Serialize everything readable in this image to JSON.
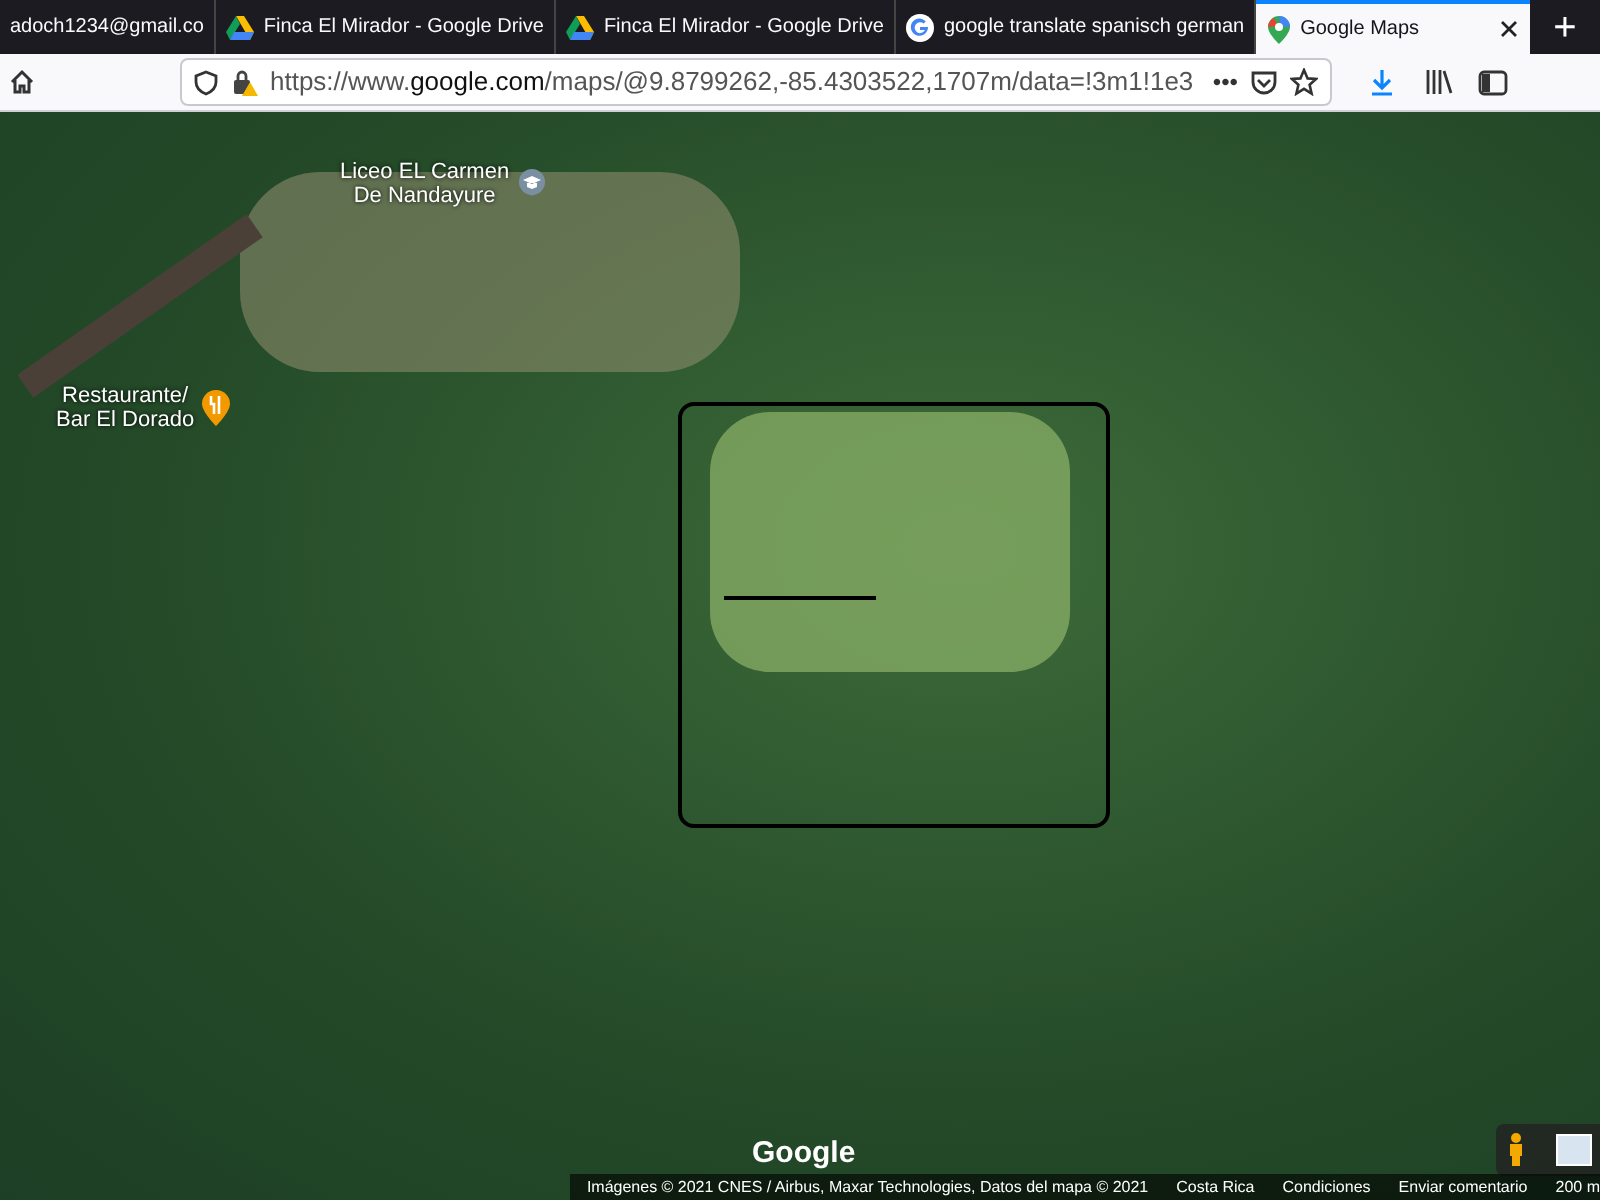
{
  "tabs": [
    {
      "label": "adoch1234@gmail.co",
      "kind": "plain",
      "selected": false
    },
    {
      "label": "Finca El Mirador - Google Drive",
      "kind": "drive",
      "selected": false
    },
    {
      "label": "Finca El Mirador - Google Drive",
      "kind": "drive",
      "selected": false
    },
    {
      "label": "google translate spanisch german",
      "kind": "google",
      "selected": false
    },
    {
      "label": "Google Maps",
      "kind": "maps",
      "selected": true
    }
  ],
  "new_tab": "+",
  "address_bar": {
    "url": "https://www.**google.com**/maps/@9.8799262,-85.4303522,1707m/data=!3m1!1e3",
    "menu": "•••"
  },
  "map": {
    "places": [
      {
        "label": "Liceo EL Carmen\nDe Nandayure",
        "kind": "school"
      },
      {
        "label": "Restaurante/\nBar El Dorado",
        "kind": "restaurant"
      }
    ],
    "logo": "Google",
    "attribution": [
      "Imágenes © 2021 CNES / Airbus, Maxar Technologies, Datos del mapa © 2021",
      "Costa Rica",
      "Condiciones",
      "Enviar comentario",
      "200 m"
    ]
  }
}
